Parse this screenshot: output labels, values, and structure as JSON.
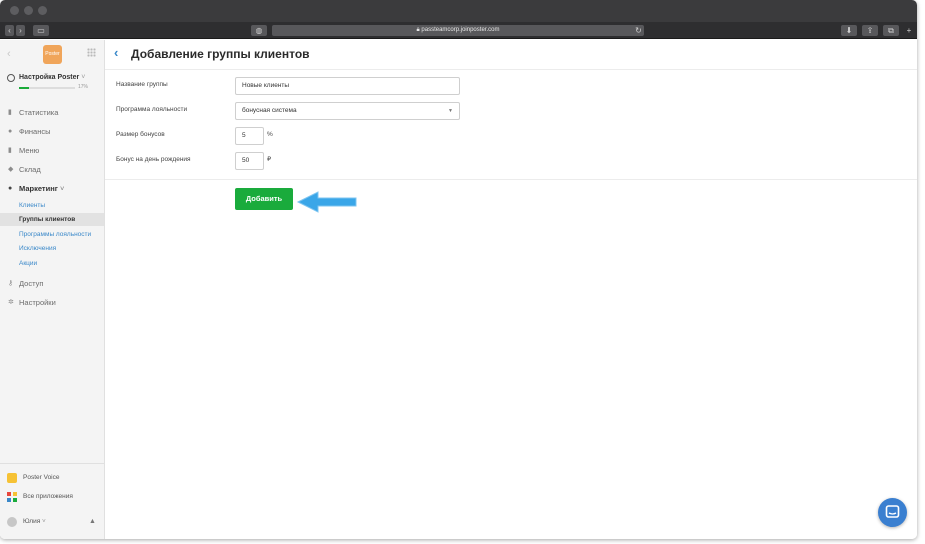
{
  "browser": {
    "url": "passteamcorp.joinposter.com",
    "accent": "#3b3b3d"
  },
  "sidebar": {
    "logo_text": "Poster",
    "account": {
      "name": "Настройка Poster",
      "progress_percent": 17,
      "progress_text": "17%"
    },
    "items": [
      {
        "label": "Статистика",
        "icon": "chart-icon"
      },
      {
        "label": "Финансы",
        "icon": "coin-icon"
      },
      {
        "label": "Меню",
        "icon": "document-icon"
      },
      {
        "label": "Склад",
        "icon": "box-icon"
      },
      {
        "label": "Маркетинг",
        "icon": "megaphone-icon",
        "expanded": true
      }
    ],
    "marketing_sub": [
      {
        "label": "Клиенты"
      },
      {
        "label": "Группы клиентов",
        "active": true
      },
      {
        "label": "Программы лояльности"
      },
      {
        "label": "Исключения"
      },
      {
        "label": "Акции"
      }
    ],
    "items_after": [
      {
        "label": "Доступ",
        "icon": "key-icon"
      },
      {
        "label": "Настройки",
        "icon": "gear-icon"
      }
    ],
    "bottom": {
      "voice": "Poster Voice",
      "apps": "Все приложения",
      "user": "Юлия"
    }
  },
  "main": {
    "title": "Добавление группы клиентов",
    "form": {
      "group_name_label": "Название группы",
      "group_name_value": "Новые клиенты",
      "loyalty_label": "Программа лояльности",
      "loyalty_value": "бонусная система",
      "bonus_size_label": "Размер бонусов",
      "bonus_size_value": "5",
      "bonus_size_unit": "%",
      "birthday_label": "Бонус на день рождения",
      "birthday_value": "50",
      "birthday_unit": "₽"
    },
    "add_button": "Добавить"
  },
  "colors": {
    "primary_green": "#1aab3c",
    "link_blue": "#3a88c9",
    "annotation_arrow": "#3aa6e8"
  }
}
